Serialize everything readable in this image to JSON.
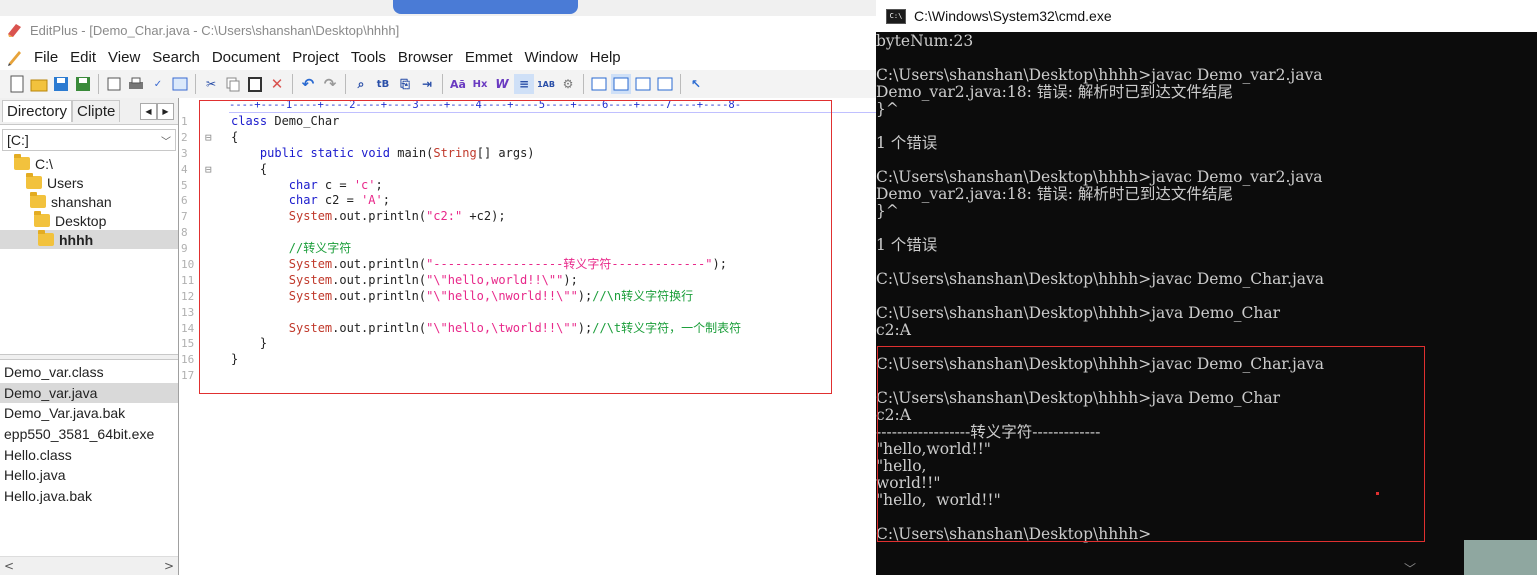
{
  "editplus": {
    "title": "EditPlus - [Demo_Char.java - C:\\Users\\shanshan\\Desktop\\hhhh]",
    "menu": [
      "File",
      "Edit",
      "View",
      "Search",
      "Document",
      "Project",
      "Tools",
      "Browser",
      "Emmet",
      "Window",
      "Help"
    ],
    "toolbar_icons": [
      "new-file-icon",
      "open-folder-icon",
      "save-icon",
      "save-all-icon",
      "print-preview-icon",
      "print-icon",
      "spell-check-icon",
      "browser-preview-icon",
      "cut-icon",
      "copy-icon",
      "paste-icon",
      "delete-icon",
      "undo-icon",
      "redo-icon",
      "find-icon",
      "replace-icon",
      "find-in-files-icon",
      "goto-icon",
      "font-size-icon",
      "hex-icon",
      "word-wrap-icon",
      "indent-icon",
      "line-numbers-icon",
      "settings-icon",
      "view-1-icon",
      "view-2-icon",
      "view-3-icon",
      "view-4-icon",
      "help-pointer-icon"
    ],
    "left_pane": {
      "tabs": [
        "Directory",
        "Clipte"
      ],
      "drive": "[C:]",
      "tree": [
        "C:\\",
        "Users",
        "shanshan",
        "Desktop",
        "hhhh"
      ],
      "files": [
        "Demo_var.class",
        "Demo_var.java",
        "Demo_Var.java.bak",
        "epp550_3581_64bit.exe",
        "Hello.class",
        "Hello.java",
        "Hello.java.bak"
      ]
    },
    "ruler": "----+----1----+----2----+----3----+----4----+----5----+----6----+----7----+----8-",
    "code_lines": [
      {
        "n": "1",
        "fold": "",
        "text": "class Demo_Char"
      },
      {
        "n": "2",
        "fold": "⊟",
        "text": "{"
      },
      {
        "n": "3",
        "fold": "",
        "text": "    public static void main(String[] args)"
      },
      {
        "n": "4",
        "fold": "⊟",
        "text": "    {"
      },
      {
        "n": "5",
        "fold": "",
        "text": "        char c = 'c';"
      },
      {
        "n": "6",
        "fold": "",
        "text": "        char c2 = 'A';"
      },
      {
        "n": "7",
        "fold": "",
        "text": "        System.out.println(\"c2:\" +c2);"
      },
      {
        "n": "8",
        "fold": "",
        "text": ""
      },
      {
        "n": "9",
        "fold": "",
        "text": "        //转义字符"
      },
      {
        "n": "10",
        "fold": "",
        "text": "        System.out.println(\"------------------转义字符-------------\");"
      },
      {
        "n": "11",
        "fold": "",
        "text": "        System.out.println(\"\\\"hello,world!!\\\"\");"
      },
      {
        "n": "12",
        "fold": "",
        "text": "        System.out.println(\"\\\"hello,\\nworld!!\\\"\");//\\n转义字符换行"
      },
      {
        "n": "13",
        "fold": "",
        "text": ""
      },
      {
        "n": "14",
        "fold": "",
        "text": "        System.out.println(\"\\\"hello,\\tworld!!\\\"\");//\\t转义字符，一个制表符"
      },
      {
        "n": "15",
        "fold": "",
        "text": "    }"
      },
      {
        "n": "16",
        "fold": "",
        "text": "}"
      },
      {
        "n": "17",
        "fold": "",
        "text": ""
      }
    ]
  },
  "cmd": {
    "title": "C:\\Windows\\System32\\cmd.exe",
    "lines": [
      "byteNum:23",
      "",
      "C:\\Users\\shanshan\\Desktop\\hhhh>javac Demo_var2.java",
      "Demo_var2.java:18: 错误: 解析时已到达文件结尾",
      "}^",
      "",
      "1 个错误",
      "",
      "C:\\Users\\shanshan\\Desktop\\hhhh>javac Demo_var2.java",
      "Demo_var2.java:18: 错误: 解析时已到达文件结尾",
      "}^",
      "",
      "1 个错误",
      "",
      "C:\\Users\\shanshan\\Desktop\\hhhh>javac Demo_Char.java",
      "",
      "C:\\Users\\shanshan\\Desktop\\hhhh>java Demo_Char",
      "c2:A",
      "",
      "C:\\Users\\shanshan\\Desktop\\hhhh>javac Demo_Char.java",
      "",
      "C:\\Users\\shanshan\\Desktop\\hhhh>java Demo_Char",
      "c2:A",
      "------------------转义字符-------------",
      "\"hello,world!!\"",
      "\"hello,",
      "world!!\"",
      "\"hello,  world!!\"",
      "",
      "C:\\Users\\shanshan\\Desktop\\hhhh>"
    ]
  },
  "colors": {
    "keyword": "#1a1acd",
    "string": "#e8288a",
    "comment": "#1b9e3a",
    "class_name": "#c0392b",
    "ruler": "#1e2ed0",
    "annotation_box": "#e03030",
    "console_bg": "#0c0c0c",
    "console_fg": "#cccccc"
  }
}
